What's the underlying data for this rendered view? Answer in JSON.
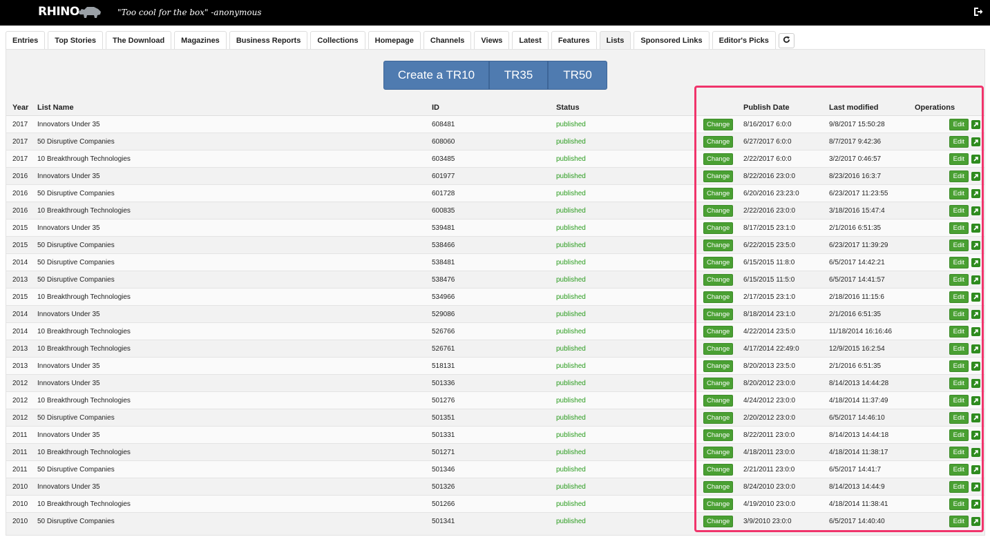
{
  "header": {
    "logo": "RHINO",
    "tagline": "\"Too cool for the box\" -anonymous"
  },
  "tabs": [
    "Entries",
    "Top Stories",
    "The Download",
    "Magazines",
    "Business Reports",
    "Collections",
    "Homepage",
    "Channels",
    "Views",
    "Latest",
    "Features",
    "Lists",
    "Sponsored Links",
    "Editor's Picks"
  ],
  "active_tab": "Lists",
  "create_buttons": {
    "tr10": "Create a TR10",
    "tr35": "TR35",
    "tr50": "TR50"
  },
  "columns": {
    "year": "Year",
    "name": "List Name",
    "id": "ID",
    "status": "Status",
    "publish": "Publish Date",
    "modified": "Last modified",
    "ops": "Operations"
  },
  "labels": {
    "change": "Change",
    "edit": "Edit"
  },
  "rows": [
    {
      "year": "2017",
      "name": "Innovators Under 35",
      "id": "608481",
      "status": "published",
      "publish": "8/16/2017 6:0:0",
      "modified": "9/8/2017 15:50:28"
    },
    {
      "year": "2017",
      "name": "50 Disruptive Companies",
      "id": "608060",
      "status": "published",
      "publish": "6/27/2017 6:0:0",
      "modified": "8/7/2017 9:42:36"
    },
    {
      "year": "2017",
      "name": "10 Breakthrough Technologies",
      "id": "603485",
      "status": "published",
      "publish": "2/22/2017 6:0:0",
      "modified": "3/2/2017 0:46:57"
    },
    {
      "year": "2016",
      "name": "Innovators Under 35",
      "id": "601977",
      "status": "published",
      "publish": "8/22/2016 23:0:0",
      "modified": "8/23/2016 16:3:7"
    },
    {
      "year": "2016",
      "name": "50 Disruptive Companies",
      "id": "601728",
      "status": "published",
      "publish": "6/20/2016 23:23:0",
      "modified": "6/23/2017 11:23:55"
    },
    {
      "year": "2016",
      "name": "10 Breakthrough Technologies",
      "id": "600835",
      "status": "published",
      "publish": "2/22/2016 23:0:0",
      "modified": "3/18/2016 15:47:4"
    },
    {
      "year": "2015",
      "name": "Innovators Under 35",
      "id": "539481",
      "status": "published",
      "publish": "8/17/2015 23:1:0",
      "modified": "2/1/2016 6:51:35"
    },
    {
      "year": "2015",
      "name": "50 Disruptive Companies",
      "id": "538466",
      "status": "published",
      "publish": "6/22/2015 23:5:0",
      "modified": "6/23/2017 11:39:29"
    },
    {
      "year": "2014",
      "name": "50 Disruptive Companies",
      "id": "538481",
      "status": "published",
      "publish": "6/15/2015 11:8:0",
      "modified": "6/5/2017 14:42:21"
    },
    {
      "year": "2013",
      "name": "50 Disruptive Companies",
      "id": "538476",
      "status": "published",
      "publish": "6/15/2015 11:5:0",
      "modified": "6/5/2017 14:41:57"
    },
    {
      "year": "2015",
      "name": "10 Breakthrough Technologies",
      "id": "534966",
      "status": "published",
      "publish": "2/17/2015 23:1:0",
      "modified": "2/18/2016 11:15:6"
    },
    {
      "year": "2014",
      "name": "Innovators Under 35",
      "id": "529086",
      "status": "published",
      "publish": "8/18/2014 23:1:0",
      "modified": "2/1/2016 6:51:35"
    },
    {
      "year": "2014",
      "name": "10 Breakthrough Technologies",
      "id": "526766",
      "status": "published",
      "publish": "4/22/2014 23:5:0",
      "modified": "11/18/2014 16:16:46"
    },
    {
      "year": "2013",
      "name": "10 Breakthrough Technologies",
      "id": "526761",
      "status": "published",
      "publish": "4/17/2014 22:49:0",
      "modified": "12/9/2015 16:2:54"
    },
    {
      "year": "2013",
      "name": "Innovators Under 35",
      "id": "518131",
      "status": "published",
      "publish": "8/20/2013 23:5:0",
      "modified": "2/1/2016 6:51:35"
    },
    {
      "year": "2012",
      "name": "Innovators Under 35",
      "id": "501336",
      "status": "published",
      "publish": "8/20/2012 23:0:0",
      "modified": "8/14/2013 14:44:28"
    },
    {
      "year": "2012",
      "name": "10 Breakthrough Technologies",
      "id": "501276",
      "status": "published",
      "publish": "4/24/2012 23:0:0",
      "modified": "4/18/2014 11:37:49"
    },
    {
      "year": "2012",
      "name": "50 Disruptive Companies",
      "id": "501351",
      "status": "published",
      "publish": "2/20/2012 23:0:0",
      "modified": "6/5/2017 14:46:10"
    },
    {
      "year": "2011",
      "name": "Innovators Under 35",
      "id": "501331",
      "status": "published",
      "publish": "8/22/2011 23:0:0",
      "modified": "8/14/2013 14:44:18"
    },
    {
      "year": "2011",
      "name": "10 Breakthrough Technologies",
      "id": "501271",
      "status": "published",
      "publish": "4/18/2011 23:0:0",
      "modified": "4/18/2014 11:38:17"
    },
    {
      "year": "2011",
      "name": "50 Disruptive Companies",
      "id": "501346",
      "status": "published",
      "publish": "2/21/2011 23:0:0",
      "modified": "6/5/2017 14:41:7"
    },
    {
      "year": "2010",
      "name": "Innovators Under 35",
      "id": "501326",
      "status": "published",
      "publish": "8/24/2010 23:0:0",
      "modified": "8/14/2013 14:44:9"
    },
    {
      "year": "2010",
      "name": "10 Breakthrough Technologies",
      "id": "501266",
      "status": "published",
      "publish": "4/19/2010 23:0:0",
      "modified": "4/18/2014 11:38:41"
    },
    {
      "year": "2010",
      "name": "50 Disruptive Companies",
      "id": "501341",
      "status": "published",
      "publish": "3/9/2010 23:0:0",
      "modified": "6/5/2017 14:40:40"
    }
  ],
  "colors": {
    "accent": "#4f7bb0",
    "published": "#2a9c1e",
    "action": "#4aa033",
    "highlight": "#f0346b"
  },
  "icons": {
    "logout": "logout-icon",
    "refresh": "refresh-icon",
    "open": "external-link-icon",
    "logo": "rhino-icon"
  }
}
